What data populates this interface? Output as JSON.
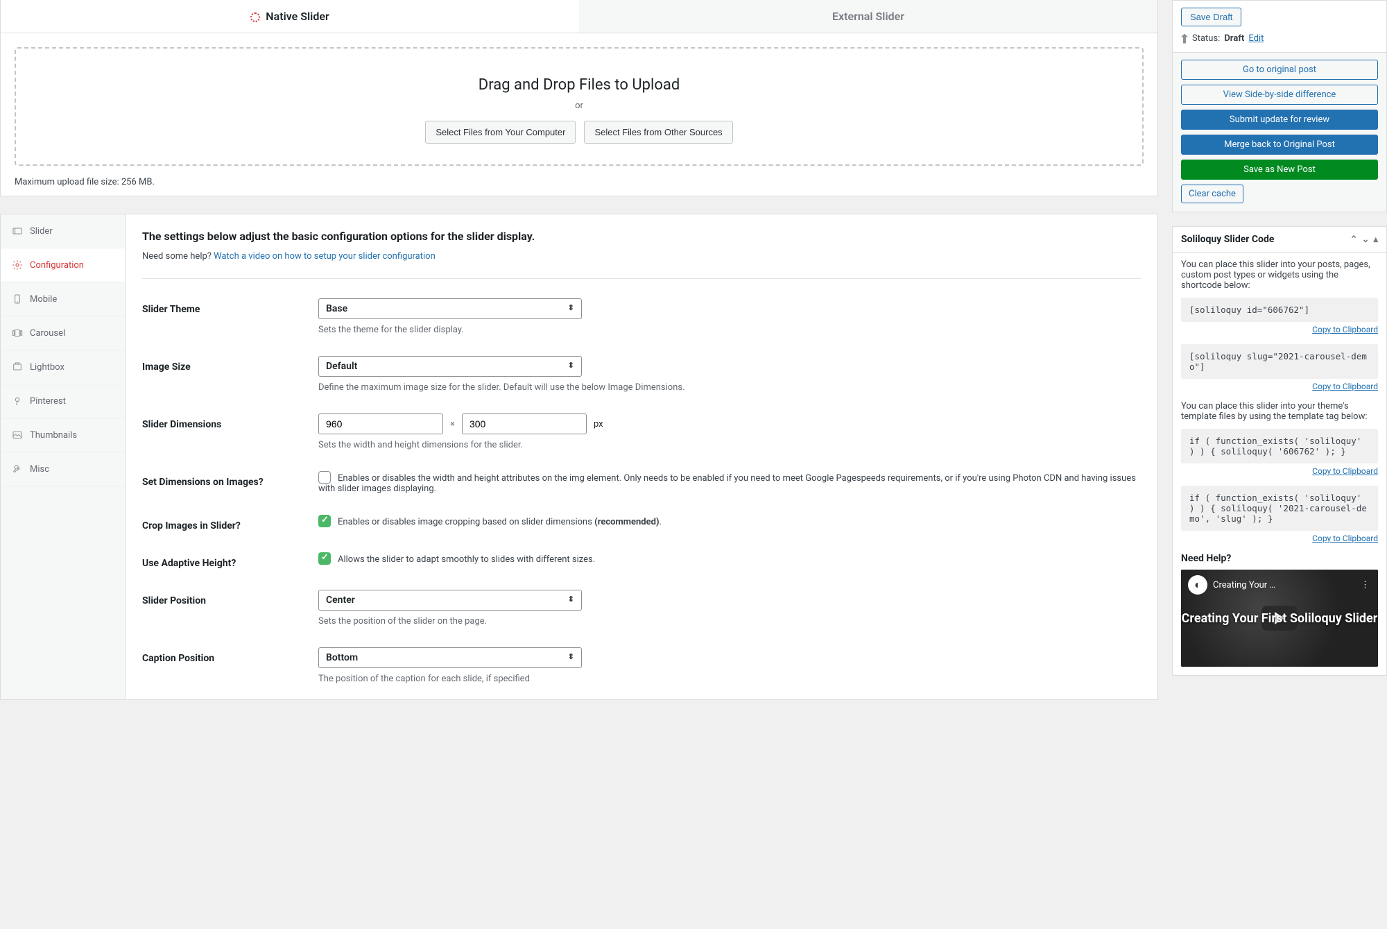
{
  "tabs": {
    "native": "Native Slider",
    "external": "External Slider"
  },
  "upload": {
    "heading": "Drag and Drop Files to Upload",
    "or": "or",
    "btn_computer": "Select Files from Your Computer",
    "btn_other": "Select Files from Other Sources",
    "limit": "Maximum upload file size: 256 MB."
  },
  "nav": {
    "slider": "Slider",
    "config": "Configuration",
    "mobile": "Mobile",
    "carousel": "Carousel",
    "lightbox": "Lightbox",
    "pinterest": "Pinterest",
    "thumbnails": "Thumbnails",
    "misc": "Misc"
  },
  "config": {
    "heading": "The settings below adjust the basic configuration options for the slider display.",
    "help_prefix": "Need some help?  ",
    "help_link": "Watch a video on how to setup your slider configuration",
    "theme_label": "Slider Theme",
    "theme_value": "Base",
    "theme_hint": "Sets the theme for the slider display.",
    "imgsize_label": "Image Size",
    "imgsize_value": "Default",
    "imgsize_hint": "Define the maximum image size for the slider. Default will use the below Image Dimensions.",
    "dims_label": "Slider Dimensions",
    "dims_w": "960",
    "dims_h": "300",
    "dims_x": "×",
    "dims_px": "px",
    "dims_hint": "Sets the width and height dimensions for the slider.",
    "setdims_label": "Set Dimensions on Images?",
    "setdims_desc": "Enables or disables the width and height attributes on the img element. Only needs to be enabled if you need to meet Google Pagespeeds requirements, or if you're using Photon CDN and having issues with slider images displaying.",
    "crop_label": "Crop Images in Slider?",
    "crop_desc_a": "Enables or disables image cropping based on slider dimensions ",
    "crop_desc_b": "(recommended)",
    "crop_desc_c": ".",
    "adapt_label": "Use Adaptive Height?",
    "adapt_desc": "Allows the slider to adapt smoothly to slides with different sizes.",
    "pos_label": "Slider Position",
    "pos_value": "Center",
    "pos_hint": "Sets the position of the slider on the page.",
    "cap_label": "Caption Position",
    "cap_value": "Bottom",
    "cap_hint": "The position of the caption for each slide, if specified"
  },
  "publish": {
    "save_draft": "Save Draft",
    "status_label": "Status:",
    "status_value": "Draft",
    "edit": "Edit",
    "go_original": "Go to original post",
    "view_diff": "View Side-by-side difference",
    "submit": "Submit update for review",
    "merge": "Merge back to Original Post",
    "save_new": "Save as New Post",
    "clear": "Clear cache"
  },
  "code": {
    "title": "Soliloquy Slider Code",
    "desc1": "You can place this slider into your posts, pages, custom post types or widgets using the shortcode below:",
    "sc1": "[soliloquy id=\"606762\"]",
    "sc2": "[soliloquy slug=\"2021-carousel-demo\"]",
    "desc2": "You can place this slider into your theme's template files by using the template tag below:",
    "php1": "if ( function_exists( 'soliloquy' ) ) { soliloquy( '606762' ); }",
    "php2": "if ( function_exists( 'soliloquy' ) ) { soliloquy( '2021-carousel-demo', 'slug' ); }",
    "copy": "Copy to Clipboard",
    "needhelp": "Need Help?",
    "video_top": "Creating Your …",
    "video_title": "Creating Your First Soliloquy Slider"
  }
}
